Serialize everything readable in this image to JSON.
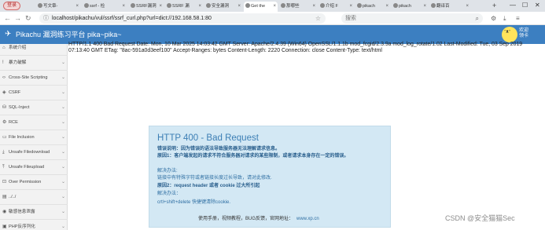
{
  "browser": {
    "profile_label": "登录",
    "tabs": [
      {
        "label": "写文章-",
        "active": false
      },
      {
        "label": "ssrf - 检",
        "active": false
      },
      {
        "label": "SSRF漏洞",
        "active": false
      },
      {
        "label": "SSRF 漏",
        "active": false
      },
      {
        "label": "安全漏洞",
        "active": false
      },
      {
        "label": "Get the",
        "active": true
      },
      {
        "label": "那哪些",
        "active": false
      },
      {
        "label": "介绍 F",
        "active": false
      },
      {
        "label": "pikach",
        "active": false
      },
      {
        "label": "pikach",
        "active": false
      },
      {
        "label": "翻译百",
        "active": false
      }
    ],
    "url": "localhost/pikachu/vul/ssrf/ssrf_curl.php?url=dict://192.168.58.1:80",
    "search_placeholder": "搜索"
  },
  "app": {
    "title": "Pikachu 漏洞练习平台 pika~pika~",
    "welcome": "欢迎\n领卡"
  },
  "sidebar": {
    "items": [
      {
        "icon": "home-icon",
        "label": "系统介绍"
      },
      {
        "icon": "exclamation-icon",
        "label": "暴力破解"
      },
      {
        "icon": "code-icon",
        "label": "Cross-Site Scripting"
      },
      {
        "icon": "shield-icon",
        "label": "CSRF"
      },
      {
        "icon": "database-icon",
        "label": "SQL-Inject"
      },
      {
        "icon": "gear-icon",
        "label": "RCE"
      },
      {
        "icon": "file-icon",
        "label": "File Inclusion"
      },
      {
        "icon": "download-icon",
        "label": "Unsafe Filedownload"
      },
      {
        "icon": "upload-icon",
        "label": "Unsafe Fileupload"
      },
      {
        "icon": "lock-icon",
        "label": "Over Permission"
      },
      {
        "icon": "folder-icon",
        "label": "../../"
      },
      {
        "icon": "eye-icon",
        "label": "敏感信息泄露"
      },
      {
        "icon": "php-icon",
        "label": "PHP反序列化"
      }
    ]
  },
  "response_text": "HTTP/1.1 400 Bad Request Date: Mon, 10 Mar 2025 14:03:42 GMT Server: Apache/2.4.39 (Win64) OpenSSL/1.1.1b mod_fcgid/2.3.9a mod_log_rotate/1.02 Last-Modified: Tue, 03 Sep 2019 07:13:40 GMT ETag: \"8ac-591a0d3eef100\" Accept-Ranges: bytes Content-Length: 2220 Connection: close Content-Type: text/html",
  "error_page": {
    "title": "HTTP 400 - Bad Request",
    "line1": "错误说明：因为错误的语法导致服务器无法理解请求信息。",
    "line2": "原因1：客户端发起的请求不符合服务器对请求的某些限制，或者请求本身存在一定的错误。",
    "line3": "解决办法:",
    "line4": "链接中有特殊字符或者链接长度过长导致，请对此修改.",
    "line5": "原因2：request header 或者 cookie 过大所引起",
    "line6": "解决办法：",
    "line7": "crtl+shift+delete 快捷键清除cookie.",
    "footer": "使用手册，视频教程，BUG反馈，官网地址：",
    "site": "www.xp.cn"
  },
  "watermark": "CSDN @安全猫猫Sec"
}
